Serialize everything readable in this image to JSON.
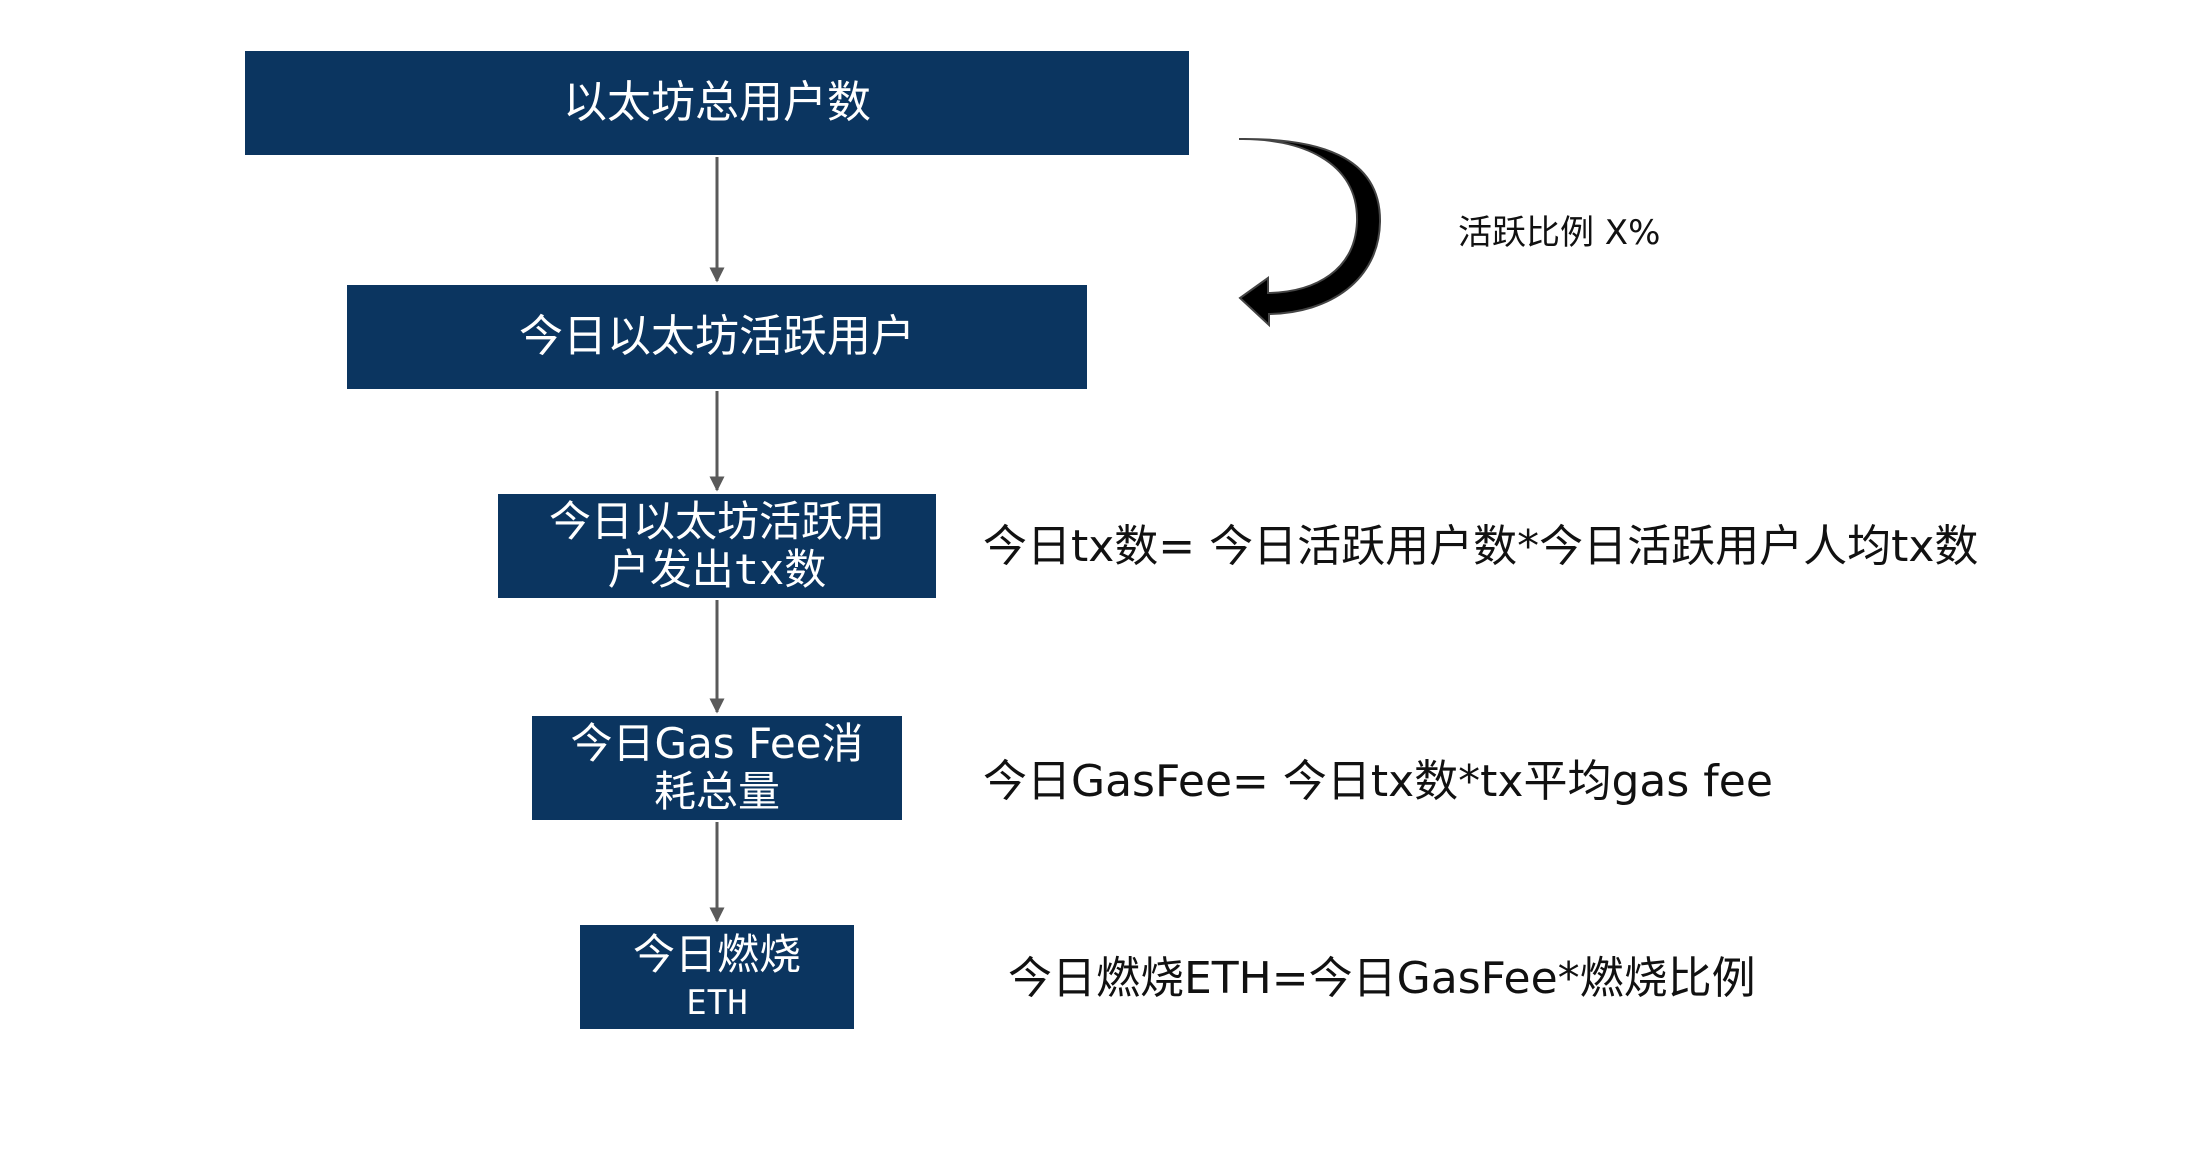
{
  "flow": {
    "step1": "以太坊总用户数",
    "step2": "今日以太坊活跃用户",
    "step3_line1": "今日以太坊活跃用",
    "step3_line2a": "户发出",
    "step3_line2b": "tx",
    "step3_line2c": "数",
    "step4_line1": "今日Gas Fee消",
    "step4_line2": "耗总量",
    "step5_line1": "今日燃烧",
    "step5_line2": "ETH"
  },
  "annotations": {
    "active_ratio": "活跃比例 X%",
    "tx_formula": "今日tx数= 今日活跃用户数*今日活跃用户人均tx数",
    "gasfee_formula": "今日GasFee= 今日tx数*tx平均gas fee",
    "burn_formula": "今日燃烧ETH=今日GasFee*燃烧比例"
  },
  "colors": {
    "box_fill": "#0b3560",
    "box_text": "#ffffff",
    "connector": "#5a5a5a",
    "curved_arrow": "#000000"
  }
}
